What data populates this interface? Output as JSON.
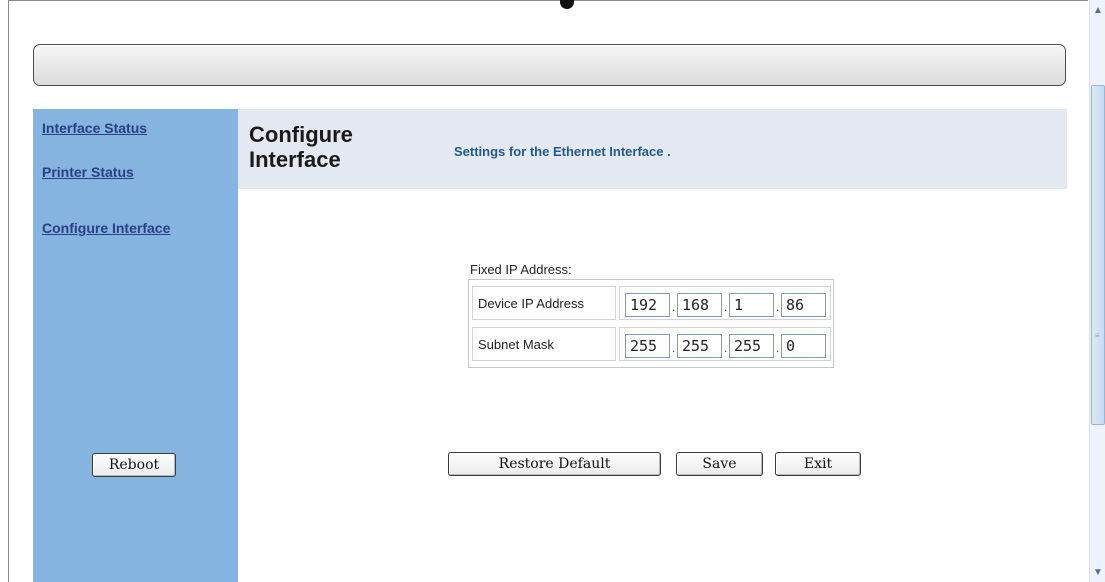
{
  "sidebar": {
    "links": [
      {
        "label": "Interface Status"
      },
      {
        "label": "Printer Status"
      },
      {
        "label": "Configure Interface"
      }
    ],
    "reboot_label": "Reboot"
  },
  "header": {
    "title": "Configure Interface",
    "subtitle": "Settings for the Ethernet Interface ."
  },
  "ip_config": {
    "section_label": "Fixed IP Address:",
    "rows": [
      {
        "label": "Device IP Address",
        "octets": [
          "192",
          "168",
          "1",
          "86"
        ]
      },
      {
        "label": "Subnet Mask",
        "octets": [
          "255",
          "255",
          "255",
          "0"
        ]
      }
    ]
  },
  "actions": {
    "restore_label": "Restore Default",
    "save_label": "Save",
    "exit_label": "Exit"
  },
  "icons": {
    "scroll_up": "chevron-up-icon",
    "scroll_down": "chevron-down-icon"
  }
}
